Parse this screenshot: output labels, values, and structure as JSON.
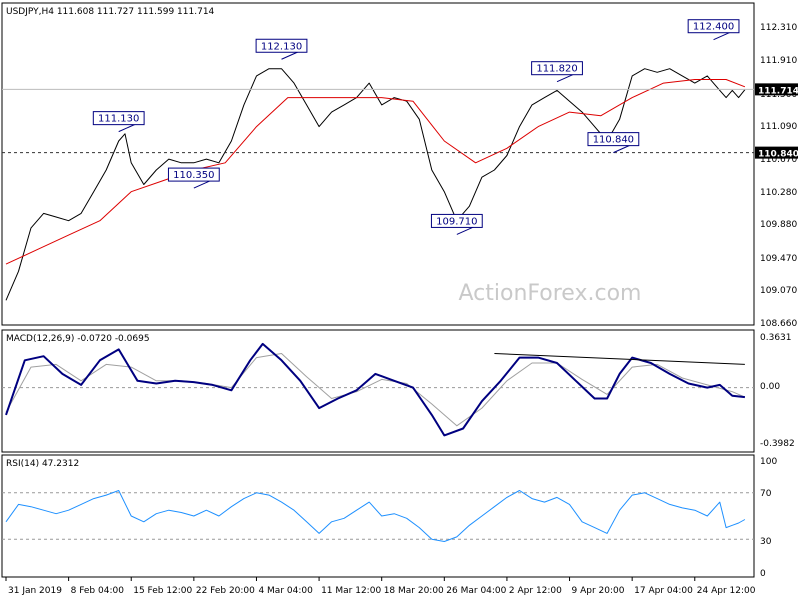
{
  "chart_data": {
    "type": "line",
    "symbol": "USDJPY,H4",
    "header": "USDJPY,H4  111.608 111.727 111.599 111.714",
    "watermark": "ActionForex.com",
    "x_labels": [
      "31 Jan 2019",
      "8 Feb 04:00",
      "15 Feb 12:00",
      "22 Feb 20:00",
      "4 Mar 04:00",
      "11 Mar 12:00",
      "18 Mar 20:00",
      "26 Mar 04:00",
      "2 Apr 12:00",
      "9 Apr 20:00",
      "17 Apr 04:00",
      "24 Apr 12:00"
    ],
    "price": {
      "ylim": [
        108.5,
        112.7
      ],
      "y_ticks": [
        "112.310",
        "111.910",
        "111.500",
        "111.090",
        "110.670",
        "110.280",
        "109.880",
        "109.470",
        "109.070",
        "108.660"
      ],
      "current": "111.714",
      "level_line": "110.840",
      "annotations": [
        {
          "text": "112.130",
          "x": 4.4,
          "y": 112.13
        },
        {
          "text": "111.130",
          "x": 1.8,
          "y": 111.13
        },
        {
          "text": "110.350",
          "x": 3.0,
          "y": 110.35
        },
        {
          "text": "109.710",
          "x": 7.2,
          "y": 109.71
        },
        {
          "text": "111.820",
          "x": 8.8,
          "y": 111.82
        },
        {
          "text": "110.840",
          "x": 9.7,
          "y": 110.84
        },
        {
          "text": "112.400",
          "x": 11.3,
          "y": 112.4
        }
      ],
      "close": [
        {
          "x": 0.0,
          "y": 108.8
        },
        {
          "x": 0.2,
          "y": 109.2
        },
        {
          "x": 0.4,
          "y": 109.8
        },
        {
          "x": 0.6,
          "y": 110.0
        },
        {
          "x": 0.8,
          "y": 109.95
        },
        {
          "x": 1.0,
          "y": 109.9
        },
        {
          "x": 1.2,
          "y": 110.0
        },
        {
          "x": 1.4,
          "y": 110.3
        },
        {
          "x": 1.6,
          "y": 110.6
        },
        {
          "x": 1.8,
          "y": 111.0
        },
        {
          "x": 1.9,
          "y": 111.1
        },
        {
          "x": 2.0,
          "y": 110.7
        },
        {
          "x": 2.2,
          "y": 110.4
        },
        {
          "x": 2.4,
          "y": 110.6
        },
        {
          "x": 2.6,
          "y": 110.75
        },
        {
          "x": 2.8,
          "y": 110.7
        },
        {
          "x": 3.0,
          "y": 110.7
        },
        {
          "x": 3.2,
          "y": 110.75
        },
        {
          "x": 3.4,
          "y": 110.7
        },
        {
          "x": 3.6,
          "y": 111.0
        },
        {
          "x": 3.8,
          "y": 111.5
        },
        {
          "x": 4.0,
          "y": 111.9
        },
        {
          "x": 4.2,
          "y": 112.0
        },
        {
          "x": 4.4,
          "y": 112.0
        },
        {
          "x": 4.6,
          "y": 111.8
        },
        {
          "x": 4.8,
          "y": 111.5
        },
        {
          "x": 5.0,
          "y": 111.2
        },
        {
          "x": 5.2,
          "y": 111.4
        },
        {
          "x": 5.4,
          "y": 111.5
        },
        {
          "x": 5.6,
          "y": 111.6
        },
        {
          "x": 5.8,
          "y": 111.8
        },
        {
          "x": 6.0,
          "y": 111.5
        },
        {
          "x": 6.2,
          "y": 111.6
        },
        {
          "x": 6.4,
          "y": 111.55
        },
        {
          "x": 6.6,
          "y": 111.3
        },
        {
          "x": 6.8,
          "y": 110.6
        },
        {
          "x": 7.0,
          "y": 110.3
        },
        {
          "x": 7.2,
          "y": 109.9
        },
        {
          "x": 7.4,
          "y": 110.1
        },
        {
          "x": 7.6,
          "y": 110.5
        },
        {
          "x": 7.8,
          "y": 110.6
        },
        {
          "x": 8.0,
          "y": 110.8
        },
        {
          "x": 8.2,
          "y": 111.2
        },
        {
          "x": 8.4,
          "y": 111.5
        },
        {
          "x": 8.6,
          "y": 111.6
        },
        {
          "x": 8.8,
          "y": 111.7
        },
        {
          "x": 9.0,
          "y": 111.55
        },
        {
          "x": 9.2,
          "y": 111.4
        },
        {
          "x": 9.4,
          "y": 111.2
        },
        {
          "x": 9.6,
          "y": 111.0
        },
        {
          "x": 9.8,
          "y": 111.3
        },
        {
          "x": 10.0,
          "y": 111.9
        },
        {
          "x": 10.2,
          "y": 112.0
        },
        {
          "x": 10.4,
          "y": 111.95
        },
        {
          "x": 10.6,
          "y": 112.0
        },
        {
          "x": 10.8,
          "y": 111.9
        },
        {
          "x": 11.0,
          "y": 111.8
        },
        {
          "x": 11.2,
          "y": 111.9
        },
        {
          "x": 11.4,
          "y": 111.7
        },
        {
          "x": 11.5,
          "y": 111.6
        },
        {
          "x": 11.6,
          "y": 111.7
        },
        {
          "x": 11.7,
          "y": 111.6
        },
        {
          "x": 11.8,
          "y": 111.71
        }
      ],
      "ma": [
        {
          "x": 0.0,
          "y": 109.3
        },
        {
          "x": 0.5,
          "y": 109.5
        },
        {
          "x": 1.0,
          "y": 109.7
        },
        {
          "x": 1.5,
          "y": 109.9
        },
        {
          "x": 2.0,
          "y": 110.3
        },
        {
          "x": 2.5,
          "y": 110.45
        },
        {
          "x": 3.0,
          "y": 110.6
        },
        {
          "x": 3.5,
          "y": 110.7
        },
        {
          "x": 4.0,
          "y": 111.2
        },
        {
          "x": 4.5,
          "y": 111.6
        },
        {
          "x": 5.0,
          "y": 111.6
        },
        {
          "x": 5.5,
          "y": 111.6
        },
        {
          "x": 6.0,
          "y": 111.6
        },
        {
          "x": 6.5,
          "y": 111.55
        },
        {
          "x": 7.0,
          "y": 111.0
        },
        {
          "x": 7.5,
          "y": 110.7
        },
        {
          "x": 8.0,
          "y": 110.9
        },
        {
          "x": 8.5,
          "y": 111.2
        },
        {
          "x": 9.0,
          "y": 111.4
        },
        {
          "x": 9.5,
          "y": 111.35
        },
        {
          "x": 10.0,
          "y": 111.6
        },
        {
          "x": 10.5,
          "y": 111.8
        },
        {
          "x": 11.0,
          "y": 111.85
        },
        {
          "x": 11.5,
          "y": 111.85
        },
        {
          "x": 11.8,
          "y": 111.75
        }
      ]
    },
    "macd": {
      "label": "MACD(12,26,9) -0.0720 -0.0695",
      "ylim": [
        -0.45,
        0.4
      ],
      "y_ticks": [
        "0.3631",
        "0.00",
        "-0.3982"
      ],
      "main": [
        {
          "x": 0.0,
          "y": -0.2
        },
        {
          "x": 0.3,
          "y": 0.2
        },
        {
          "x": 0.6,
          "y": 0.23
        },
        {
          "x": 0.9,
          "y": 0.1
        },
        {
          "x": 1.2,
          "y": 0.02
        },
        {
          "x": 1.5,
          "y": 0.2
        },
        {
          "x": 1.8,
          "y": 0.28
        },
        {
          "x": 2.1,
          "y": 0.05
        },
        {
          "x": 2.4,
          "y": 0.03
        },
        {
          "x": 2.7,
          "y": 0.05
        },
        {
          "x": 3.0,
          "y": 0.04
        },
        {
          "x": 3.3,
          "y": 0.02
        },
        {
          "x": 3.6,
          "y": -0.02
        },
        {
          "x": 3.9,
          "y": 0.2
        },
        {
          "x": 4.1,
          "y": 0.32
        },
        {
          "x": 4.4,
          "y": 0.2
        },
        {
          "x": 4.7,
          "y": 0.05
        },
        {
          "x": 5.0,
          "y": -0.15
        },
        {
          "x": 5.3,
          "y": -0.08
        },
        {
          "x": 5.6,
          "y": -0.02
        },
        {
          "x": 5.9,
          "y": 0.1
        },
        {
          "x": 6.2,
          "y": 0.05
        },
        {
          "x": 6.5,
          "y": 0.0
        },
        {
          "x": 6.8,
          "y": -0.2
        },
        {
          "x": 7.0,
          "y": -0.35
        },
        {
          "x": 7.3,
          "y": -0.3
        },
        {
          "x": 7.6,
          "y": -0.1
        },
        {
          "x": 7.9,
          "y": 0.05
        },
        {
          "x": 8.2,
          "y": 0.22
        },
        {
          "x": 8.5,
          "y": 0.22
        },
        {
          "x": 8.8,
          "y": 0.18
        },
        {
          "x": 9.1,
          "y": 0.05
        },
        {
          "x": 9.4,
          "y": -0.08
        },
        {
          "x": 9.6,
          "y": -0.08
        },
        {
          "x": 9.8,
          "y": 0.1
        },
        {
          "x": 10.0,
          "y": 0.22
        },
        {
          "x": 10.3,
          "y": 0.18
        },
        {
          "x": 10.6,
          "y": 0.1
        },
        {
          "x": 10.9,
          "y": 0.03
        },
        {
          "x": 11.2,
          "y": 0.0
        },
        {
          "x": 11.4,
          "y": 0.02
        },
        {
          "x": 11.6,
          "y": -0.06
        },
        {
          "x": 11.8,
          "y": -0.07
        }
      ],
      "signal": [
        {
          "x": 0.0,
          "y": -0.18
        },
        {
          "x": 0.4,
          "y": 0.15
        },
        {
          "x": 0.8,
          "y": 0.17
        },
        {
          "x": 1.2,
          "y": 0.05
        },
        {
          "x": 1.6,
          "y": 0.17
        },
        {
          "x": 2.0,
          "y": 0.15
        },
        {
          "x": 2.4,
          "y": 0.05
        },
        {
          "x": 2.8,
          "y": 0.05
        },
        {
          "x": 3.2,
          "y": 0.03
        },
        {
          "x": 3.6,
          "y": 0.0
        },
        {
          "x": 4.0,
          "y": 0.22
        },
        {
          "x": 4.4,
          "y": 0.25
        },
        {
          "x": 4.8,
          "y": 0.08
        },
        {
          "x": 5.2,
          "y": -0.08
        },
        {
          "x": 5.6,
          "y": -0.03
        },
        {
          "x": 6.0,
          "y": 0.06
        },
        {
          "x": 6.4,
          "y": 0.03
        },
        {
          "x": 6.8,
          "y": -0.12
        },
        {
          "x": 7.2,
          "y": -0.28
        },
        {
          "x": 7.6,
          "y": -0.15
        },
        {
          "x": 8.0,
          "y": 0.05
        },
        {
          "x": 8.4,
          "y": 0.18
        },
        {
          "x": 8.8,
          "y": 0.18
        },
        {
          "x": 9.2,
          "y": 0.06
        },
        {
          "x": 9.6,
          "y": -0.05
        },
        {
          "x": 10.0,
          "y": 0.15
        },
        {
          "x": 10.4,
          "y": 0.17
        },
        {
          "x": 10.8,
          "y": 0.07
        },
        {
          "x": 11.2,
          "y": 0.02
        },
        {
          "x": 11.6,
          "y": -0.03
        },
        {
          "x": 11.8,
          "y": -0.07
        }
      ],
      "trendline": [
        {
          "x": 7.8,
          "y": 0.25
        },
        {
          "x": 11.8,
          "y": 0.17
        }
      ]
    },
    "rsi": {
      "label": "RSI(14) 47.2312",
      "ylim": [
        0,
        100
      ],
      "y_ticks": [
        "100",
        "70",
        "30",
        "0"
      ],
      "levels": [
        70,
        30
      ],
      "values": [
        {
          "x": 0.0,
          "y": 45
        },
        {
          "x": 0.2,
          "y": 60
        },
        {
          "x": 0.4,
          "y": 58
        },
        {
          "x": 0.6,
          "y": 55
        },
        {
          "x": 0.8,
          "y": 52
        },
        {
          "x": 1.0,
          "y": 55
        },
        {
          "x": 1.2,
          "y": 60
        },
        {
          "x": 1.4,
          "y": 65
        },
        {
          "x": 1.6,
          "y": 68
        },
        {
          "x": 1.8,
          "y": 72
        },
        {
          "x": 2.0,
          "y": 50
        },
        {
          "x": 2.2,
          "y": 45
        },
        {
          "x": 2.4,
          "y": 52
        },
        {
          "x": 2.6,
          "y": 55
        },
        {
          "x": 2.8,
          "y": 53
        },
        {
          "x": 3.0,
          "y": 50
        },
        {
          "x": 3.2,
          "y": 55
        },
        {
          "x": 3.4,
          "y": 50
        },
        {
          "x": 3.6,
          "y": 58
        },
        {
          "x": 3.8,
          "y": 65
        },
        {
          "x": 4.0,
          "y": 70
        },
        {
          "x": 4.2,
          "y": 68
        },
        {
          "x": 4.4,
          "y": 62
        },
        {
          "x": 4.6,
          "y": 55
        },
        {
          "x": 4.8,
          "y": 45
        },
        {
          "x": 5.0,
          "y": 35
        },
        {
          "x": 5.2,
          "y": 45
        },
        {
          "x": 5.4,
          "y": 48
        },
        {
          "x": 5.6,
          "y": 55
        },
        {
          "x": 5.8,
          "y": 62
        },
        {
          "x": 6.0,
          "y": 50
        },
        {
          "x": 6.2,
          "y": 52
        },
        {
          "x": 6.4,
          "y": 48
        },
        {
          "x": 6.6,
          "y": 40
        },
        {
          "x": 6.8,
          "y": 30
        },
        {
          "x": 7.0,
          "y": 28
        },
        {
          "x": 7.2,
          "y": 32
        },
        {
          "x": 7.4,
          "y": 42
        },
        {
          "x": 7.6,
          "y": 50
        },
        {
          "x": 7.8,
          "y": 58
        },
        {
          "x": 8.0,
          "y": 66
        },
        {
          "x": 8.2,
          "y": 72
        },
        {
          "x": 8.4,
          "y": 65
        },
        {
          "x": 8.6,
          "y": 62
        },
        {
          "x": 8.8,
          "y": 66
        },
        {
          "x": 9.0,
          "y": 60
        },
        {
          "x": 9.2,
          "y": 45
        },
        {
          "x": 9.4,
          "y": 40
        },
        {
          "x": 9.6,
          "y": 35
        },
        {
          "x": 9.8,
          "y": 55
        },
        {
          "x": 10.0,
          "y": 68
        },
        {
          "x": 10.2,
          "y": 70
        },
        {
          "x": 10.4,
          "y": 65
        },
        {
          "x": 10.6,
          "y": 60
        },
        {
          "x": 10.8,
          "y": 57
        },
        {
          "x": 11.0,
          "y": 55
        },
        {
          "x": 11.2,
          "y": 50
        },
        {
          "x": 11.4,
          "y": 62
        },
        {
          "x": 11.5,
          "y": 40
        },
        {
          "x": 11.6,
          "y": 42
        },
        {
          "x": 11.7,
          "y": 44
        },
        {
          "x": 11.8,
          "y": 47
        }
      ]
    },
    "colors": {
      "price": "#000000",
      "ma": "#dd0000",
      "macd_main": "#000080",
      "macd_signal": "#a0a0a0",
      "rsi": "#1e90ff",
      "annotation": "#000080",
      "tag_bg": "#000000",
      "tag_text": "#ffffff"
    }
  }
}
